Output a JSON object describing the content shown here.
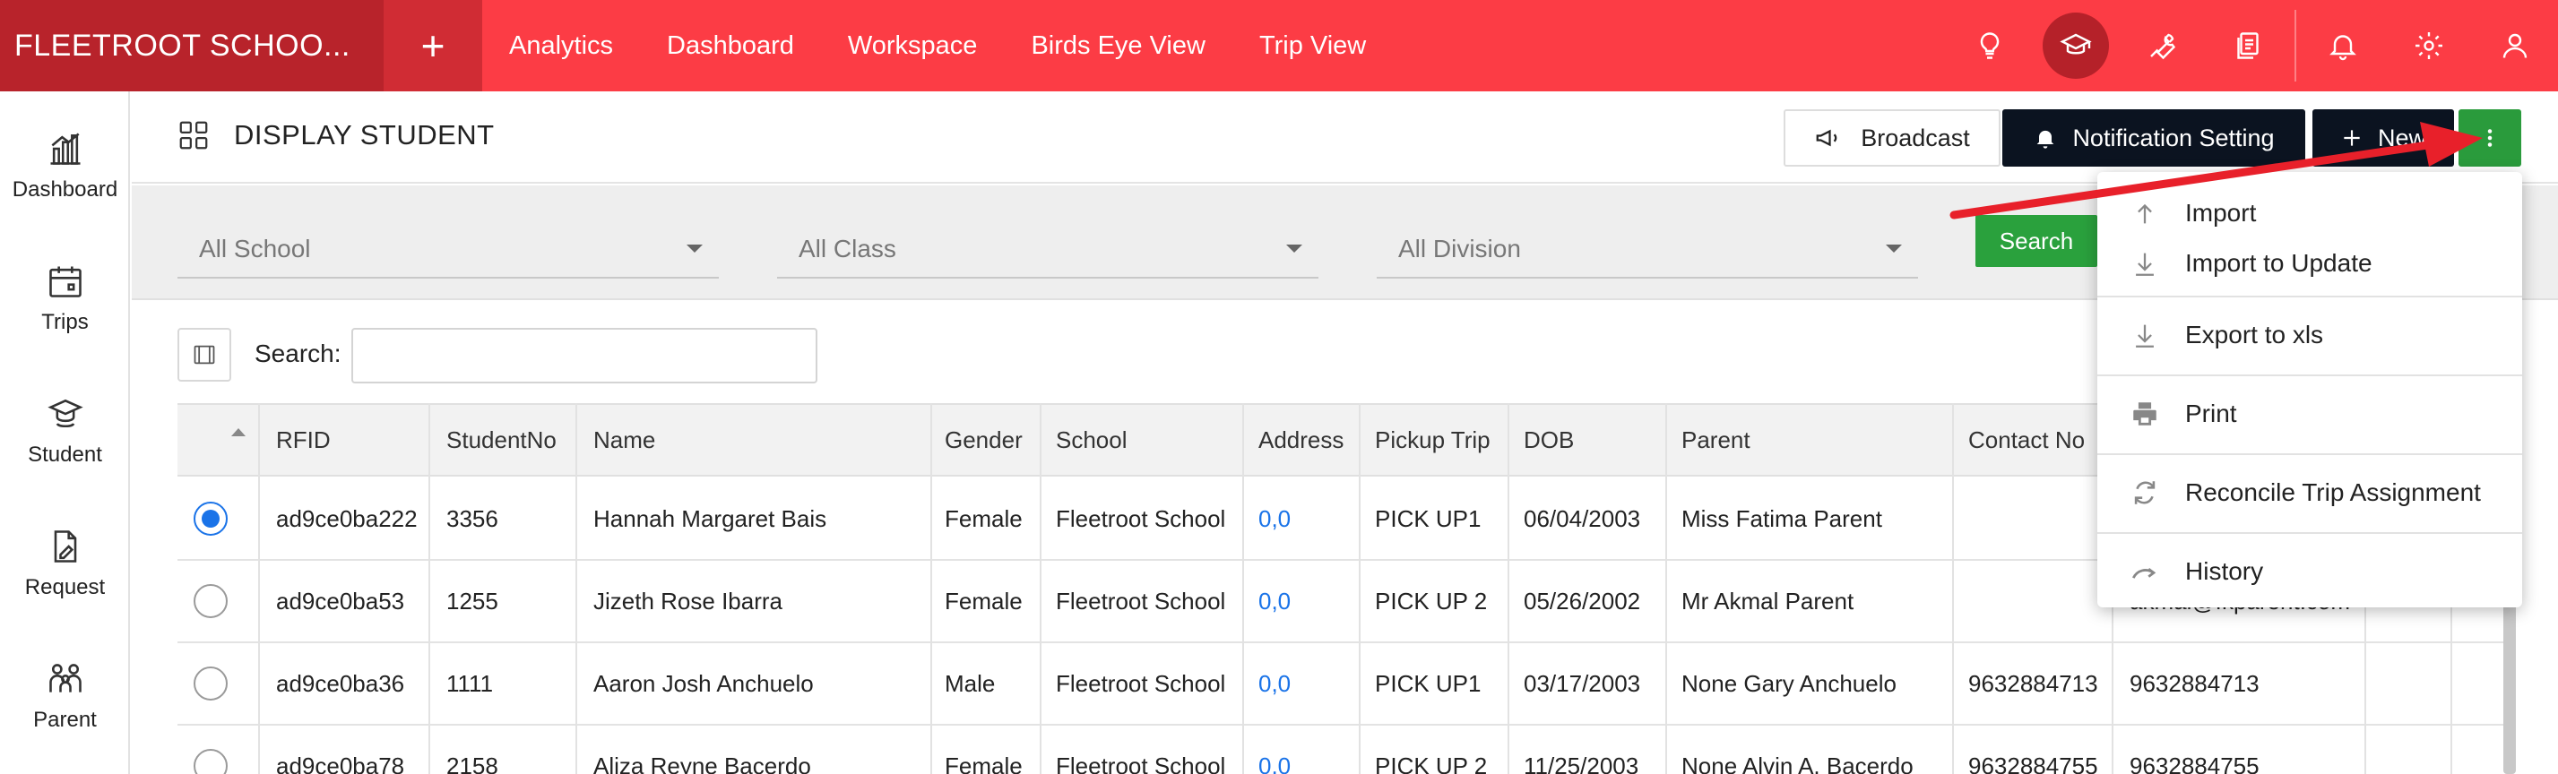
{
  "app": {
    "brand": "FLEETROOT SCHOO...",
    "plus_symbol": "+"
  },
  "topnav": {
    "items": [
      "Analytics",
      "Dashboard",
      "Workspace",
      "Birds Eye View",
      "Trip View"
    ]
  },
  "top_icons": [
    "lightbulb-icon",
    "graduation-cap-icon",
    "wrench-icon",
    "documents-icon",
    "bell-icon",
    "gear-icon",
    "user-icon"
  ],
  "sidebar": {
    "items": [
      {
        "label": "Dashboard",
        "icon": "bar-chart-icon"
      },
      {
        "label": "Trips",
        "icon": "calendar-icon"
      },
      {
        "label": "Student",
        "icon": "student-icon"
      },
      {
        "label": "Request",
        "icon": "document-edit-icon"
      },
      {
        "label": "Parent",
        "icon": "family-icon"
      }
    ]
  },
  "page": {
    "title": "DISPLAY STUDENT",
    "broadcast_label": "Broadcast",
    "notification_label": "Notification Setting",
    "new_label": "New"
  },
  "filters": {
    "school": "All School",
    "class": "All Class",
    "division": "All Division",
    "search_button": "Search"
  },
  "search": {
    "label": "Search:",
    "value": ""
  },
  "table": {
    "headers": [
      "RFID",
      "StudentNo",
      "Name",
      "Gender",
      "School",
      "Address",
      "Pickup Trip",
      "DOB",
      "Parent",
      "Contact No"
    ],
    "rows": [
      {
        "selected": true,
        "rfid": "ad9ce0ba222",
        "studentno": "3356",
        "name": "Hannah Margaret Bais",
        "gender": "Female",
        "school": "Fleetroot School",
        "address": "0,0",
        "pickup": "PICK UP1",
        "dob": "06/04/2003",
        "parent": "Miss Fatima Parent",
        "contact": "",
        "extra": ""
      },
      {
        "selected": false,
        "rfid": "ad9ce0ba53",
        "studentno": "1255",
        "name": "Jizeth Rose Ibarra",
        "gender": "Female",
        "school": "Fleetroot School",
        "address": "0,0",
        "pickup": "PICK UP 2",
        "dob": "05/26/2002",
        "parent": "Mr Akmal Parent",
        "contact": "",
        "extra": "akmal@fkparent.com"
      },
      {
        "selected": false,
        "rfid": "ad9ce0ba36",
        "studentno": "1111",
        "name": "Aaron Josh Anchuelo",
        "gender": "Male",
        "school": "Fleetroot School",
        "address": "0,0",
        "pickup": "PICK UP1",
        "dob": "03/17/2003",
        "parent": "None Gary Anchuelo",
        "contact": "9632884713",
        "extra": "9632884713"
      },
      {
        "selected": false,
        "rfid": "ad9ce0ba78",
        "studentno": "2158",
        "name": "Aliza Reyne Bacerdo",
        "gender": "Female",
        "school": "Fleetroot School",
        "address": "0,0",
        "pickup": "PICK UP 2",
        "dob": "11/25/2003",
        "parent": "None Alvin A. Bacerdo",
        "contact": "9632884755",
        "extra": "9632884755"
      }
    ]
  },
  "menu": {
    "items": [
      {
        "label": "Import",
        "icon": "upload-icon"
      },
      {
        "label": "Import to Update",
        "icon": "download-icon"
      },
      {
        "label": "Export to xls",
        "icon": "download-icon"
      },
      {
        "label": "Print",
        "icon": "printer-icon"
      },
      {
        "label": "Reconcile Trip Assignment",
        "icon": "refresh-icon"
      },
      {
        "label": "History",
        "icon": "history-icon"
      }
    ]
  },
  "colors": {
    "topbar": "#fc3c45",
    "brand_bg": "#b8232b",
    "primary_green": "#2aa13d",
    "dark_button": "#0b1320",
    "link_blue": "#1a73e8",
    "annotation_arrow": "#e8202a"
  }
}
